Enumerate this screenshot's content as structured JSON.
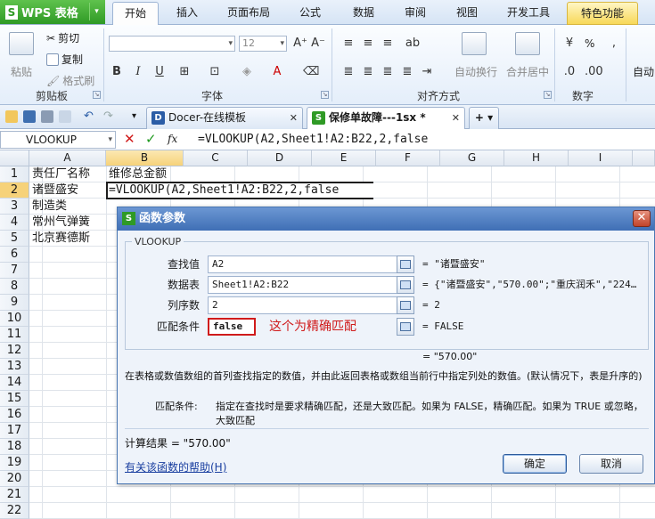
{
  "app": {
    "name": "WPS 表格",
    "logo_letter": "S"
  },
  "ribbon_tabs": [
    "开始",
    "插入",
    "页面布局",
    "公式",
    "数据",
    "审阅",
    "视图",
    "开发工具",
    "特色功能"
  ],
  "ribbon": {
    "paste": "粘贴",
    "cut": "剪切",
    "copy": "复制",
    "format_painter": "格式刷",
    "clipboard_group": "剪贴板",
    "font_size": "12",
    "font_group": "字体",
    "align_group": "对齐方式",
    "wrap_text": "自动换行",
    "merge_center": "合并居中",
    "number_group": "数字",
    "percent": "%",
    "auto": "自动",
    "bold": "B",
    "italic": "I",
    "underline": "U"
  },
  "doc_tabs": [
    {
      "label": "Docer-在线模板",
      "icon": "D"
    },
    {
      "label": "保修单故障---1sx *",
      "icon": "S"
    }
  ],
  "formula_bar": {
    "name_box": "VLOOKUP",
    "cancel": "✕",
    "confirm": "✓",
    "fx": "fx",
    "formula": "=VLOOKUP(A2,Sheet1!A2:B22,2,false"
  },
  "columns": [
    "A",
    "B",
    "C",
    "D",
    "E",
    "F",
    "G",
    "H",
    "I"
  ],
  "rows": [
    "1",
    "2",
    "3",
    "4",
    "5",
    "6",
    "7",
    "8",
    "9",
    "10",
    "11",
    "12",
    "13",
    "14",
    "15",
    "16",
    "17",
    "18",
    "19",
    "20",
    "21",
    "22"
  ],
  "cells": {
    "A1": "责任厂名称",
    "B1": "维修总金额",
    "A2": "诸暨盛安",
    "B2": "=VLOOKUP(A2,Sheet1!A2:B22,2,false",
    "A3": "制造类",
    "A4": "常州气弹簧",
    "A5": "北京赛德斯"
  },
  "dialog": {
    "logo_letter": "S",
    "title": "函数参数",
    "close": "✕",
    "function_name": "VLOOKUP",
    "args": [
      {
        "label": "查找值",
        "value": "A2",
        "result": "= \"诸暨盛安\""
      },
      {
        "label": "数据表",
        "value": "Sheet1!A2:B22",
        "result": "= {\"诸暨盛安\",\"570.00\";\"重庆润禾\",\"224…"
      },
      {
        "label": "列序数",
        "value": "2",
        "result": "= 2"
      },
      {
        "label": "匹配条件",
        "value": "false",
        "result": "= FALSE"
      }
    ],
    "annotation": "这个为精确匹配",
    "overall_result": "= \"570.00\"",
    "description": "在表格或数值数组的首列查找指定的数值，并由此返回表格或数组当前行中指定列处的数值。(默认情况下，表是升序的)",
    "param_name": "匹配条件:",
    "param_help": "指定在查找时是要求精确匹配，还是大致匹配。如果为 FALSE，精确匹配。如果为 TRUE 或忽略，大致匹配",
    "calc_result": "计算结果 = \"570.00\"",
    "help_link": "有关该函数的帮助(H)",
    "ok": "确定",
    "cancel": "取消"
  }
}
